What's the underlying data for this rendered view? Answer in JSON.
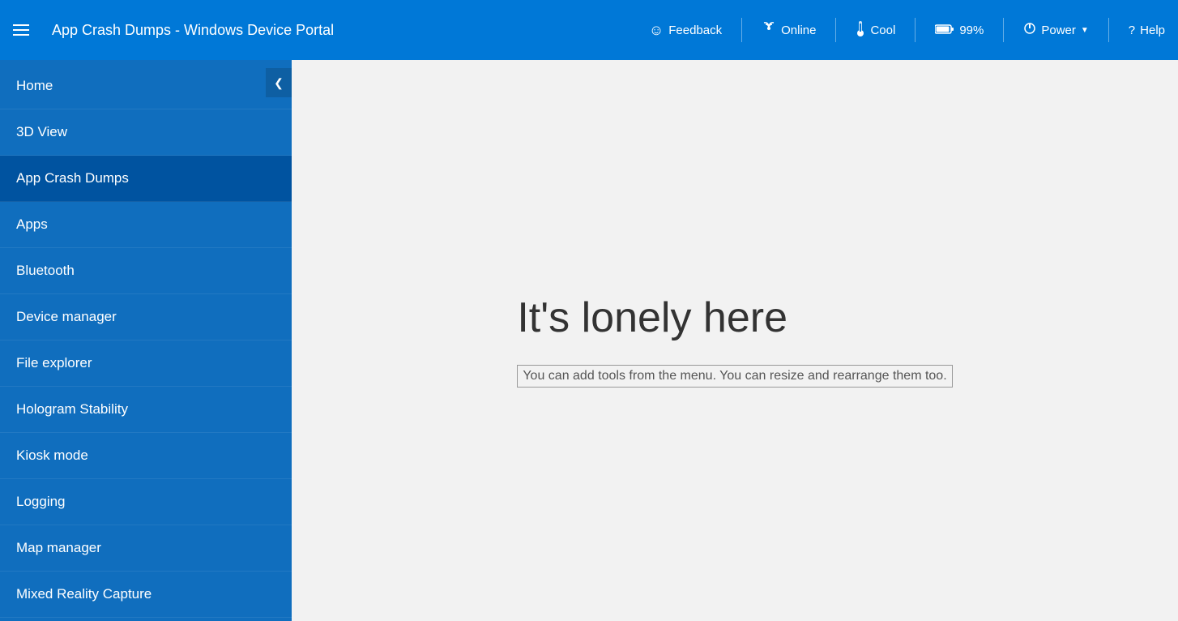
{
  "header": {
    "title": "App Crash Dumps - Windows Device Portal",
    "hamburger_label": "menu",
    "feedback_label": "Feedback",
    "online_label": "Online",
    "cool_label": "Cool",
    "battery_label": "99%",
    "power_label": "Power",
    "help_label": "Help"
  },
  "sidebar": {
    "items": [
      {
        "id": "home",
        "label": "Home",
        "active": false
      },
      {
        "id": "3d-view",
        "label": "3D View",
        "active": false
      },
      {
        "id": "app-crash-dumps",
        "label": "App Crash Dumps",
        "active": true
      },
      {
        "id": "apps",
        "label": "Apps",
        "active": false
      },
      {
        "id": "bluetooth",
        "label": "Bluetooth",
        "active": false
      },
      {
        "id": "device-manager",
        "label": "Device manager",
        "active": false
      },
      {
        "id": "file-explorer",
        "label": "File explorer",
        "active": false
      },
      {
        "id": "hologram-stability",
        "label": "Hologram Stability",
        "active": false
      },
      {
        "id": "kiosk-mode",
        "label": "Kiosk mode",
        "active": false
      },
      {
        "id": "logging",
        "label": "Logging",
        "active": false
      },
      {
        "id": "map-manager",
        "label": "Map manager",
        "active": false
      },
      {
        "id": "mixed-reality-capture",
        "label": "Mixed Reality Capture",
        "active": false
      }
    ],
    "collapse_icon": "❮"
  },
  "main": {
    "lonely_title": "It's lonely here",
    "lonely_subtitle": "You can add tools from the menu. You can resize and rearrange them too."
  },
  "icons": {
    "hamburger": "☰",
    "feedback": "☺",
    "online": "((ι))",
    "thermometer": "🌡",
    "battery": "▭",
    "power": "⏻",
    "help": "?"
  }
}
